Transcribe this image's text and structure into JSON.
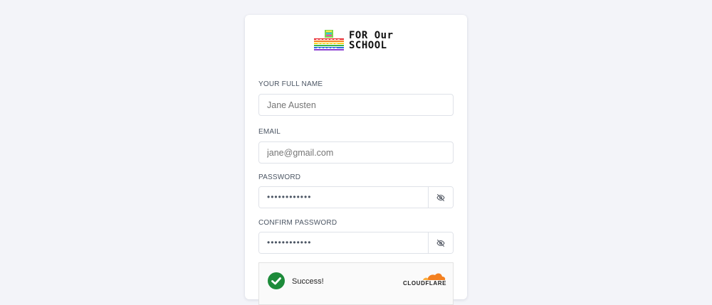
{
  "brand": {
    "line1": "FOR Our",
    "line2": "SCHOOL"
  },
  "form": {
    "full_name": {
      "label": "YOUR FULL NAME",
      "placeholder": "Jane Austen"
    },
    "email": {
      "label": "EMAIL",
      "placeholder": "jane@gmail.com"
    },
    "password": {
      "label": "PASSWORD",
      "value": "••••••••••••",
      "toggle_icon": "eye-slash-icon"
    },
    "confirm_password": {
      "label": "CONFIRM PASSWORD",
      "value": "••••••••••••",
      "toggle_icon": "eye-slash-icon"
    }
  },
  "captcha": {
    "status": "Success!",
    "provider": "CLOUDFLARE",
    "status_icon": "check-circle-icon",
    "status_color": "#1d8b3a",
    "provider_color": "#f38020"
  }
}
